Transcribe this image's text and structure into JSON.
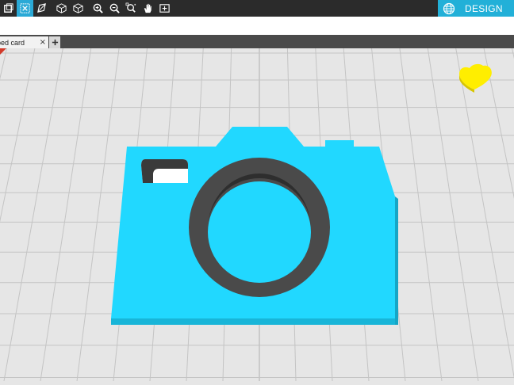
{
  "toolbar": {
    "tools": [
      {
        "name": "fit-view-icon",
        "active": false
      },
      {
        "name": "reset-view-icon",
        "active": true
      },
      {
        "name": "perspective-icon",
        "active": false
      },
      {
        "name": "front-view-icon",
        "active": false
      },
      {
        "name": "top-view-icon",
        "active": false
      },
      {
        "name": "zoom-in-icon",
        "active": false
      },
      {
        "name": "zoom-out-icon",
        "active": false
      },
      {
        "name": "zoom-region-icon",
        "active": false
      },
      {
        "name": "pan-hand-icon",
        "active": false
      },
      {
        "name": "add-object-icon",
        "active": false
      }
    ],
    "design_label": "DESIGN",
    "design_icon": "globe-icon"
  },
  "tabs": [
    {
      "label": "ped card",
      "close": "×"
    }
  ],
  "add_tab_icon": "plus-icon",
  "scene": {
    "object_color": "#21d8ff",
    "lens_ring_color": "#4d4d4d",
    "heart_color": "#ffee00",
    "grid_color": "#c4c4c4",
    "background_color": "#e6e6e6"
  }
}
